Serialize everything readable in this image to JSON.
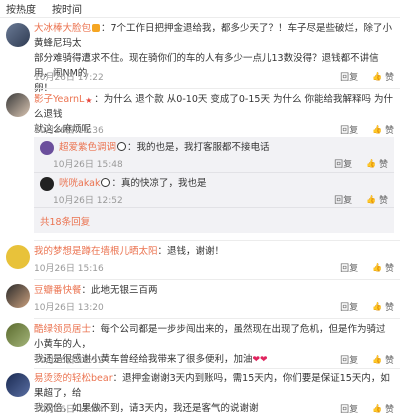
{
  "tabs": {
    "hot": "按热度",
    "time": "按时间"
  },
  "comments": [
    {
      "name": "大冰棒大脸包",
      "text1": "：7个工作日把押金退给我，都多少天了？！车子尽是些破烂，除了小黄蜂尼玛太",
      "text2": "部分难骑得遭求不住。现在骑你们的车的人有多少一点儿13数没得？退钱都不讲信用，闹NM的",
      "text3": "卵！",
      "time": "10月26日 17:22",
      "report": "举报",
      "reply": "回复",
      "like": "赞"
    },
    {
      "name": "影子YearnL",
      "text1": "：为什么 退个款 从0-10天 变成了0-15天 为什么  你能给我解释吗 为什么退钱",
      "text2": "就这么麻烦呢",
      "time": "10月26日 16:36",
      "report": "举报",
      "reply": "回复",
      "like": "赞",
      "replies": [
        {
          "name": "超爱紫色调调",
          "text": "：我的也是，我打客服都不接电话",
          "time": "10月26日 15:48",
          "report": "举报",
          "reply": "回复",
          "like": "赞"
        },
        {
          "name": "咣咣akak",
          "text": "：真的快凉了，我也是",
          "time": "10月26日 12:52",
          "report": "举报",
          "reply": "回复",
          "like": "赞"
        }
      ],
      "more": "共18条回复"
    },
    {
      "name": "我的梦想是蹲在墙根儿晒太阳",
      "text": "：退钱，谢谢！",
      "time": "10月26日 15:16",
      "report": "举报",
      "reply": "回复",
      "like": "赞"
    },
    {
      "name": "豆瓣番快餐",
      "text": "：此地无银三百两",
      "time": "10月26日 13:20",
      "report": "举报",
      "reply": "回复",
      "like": "赞"
    },
    {
      "name": "酷绿领员居士",
      "text1": "：每个公司都是一步步闯出来的，虽然现在出现了危机，但是作为骑过小黄车的人，",
      "text2": "我还是很感谢小黄车曾经给我带来了很多便利，加油",
      "time": "10月26日 12:52",
      "report": "举报",
      "reply": "回复",
      "like": "赞"
    },
    {
      "name": "易烫烫的轻松bear",
      "text1": "：退押金谢谢3天内到账吗，需15天内，你们要是保证15天内，如果超了，给",
      "text2": "我双倍，如果做不到，请3天内，我还是客气的说谢谢",
      "time": "10月26日 12:04",
      "report": "举报",
      "reply": "回复",
      "like": "赞"
    }
  ],
  "colors": {
    "name": "#eb7350",
    "meta": "#999999",
    "reply_bg": "#f2f2f5"
  }
}
